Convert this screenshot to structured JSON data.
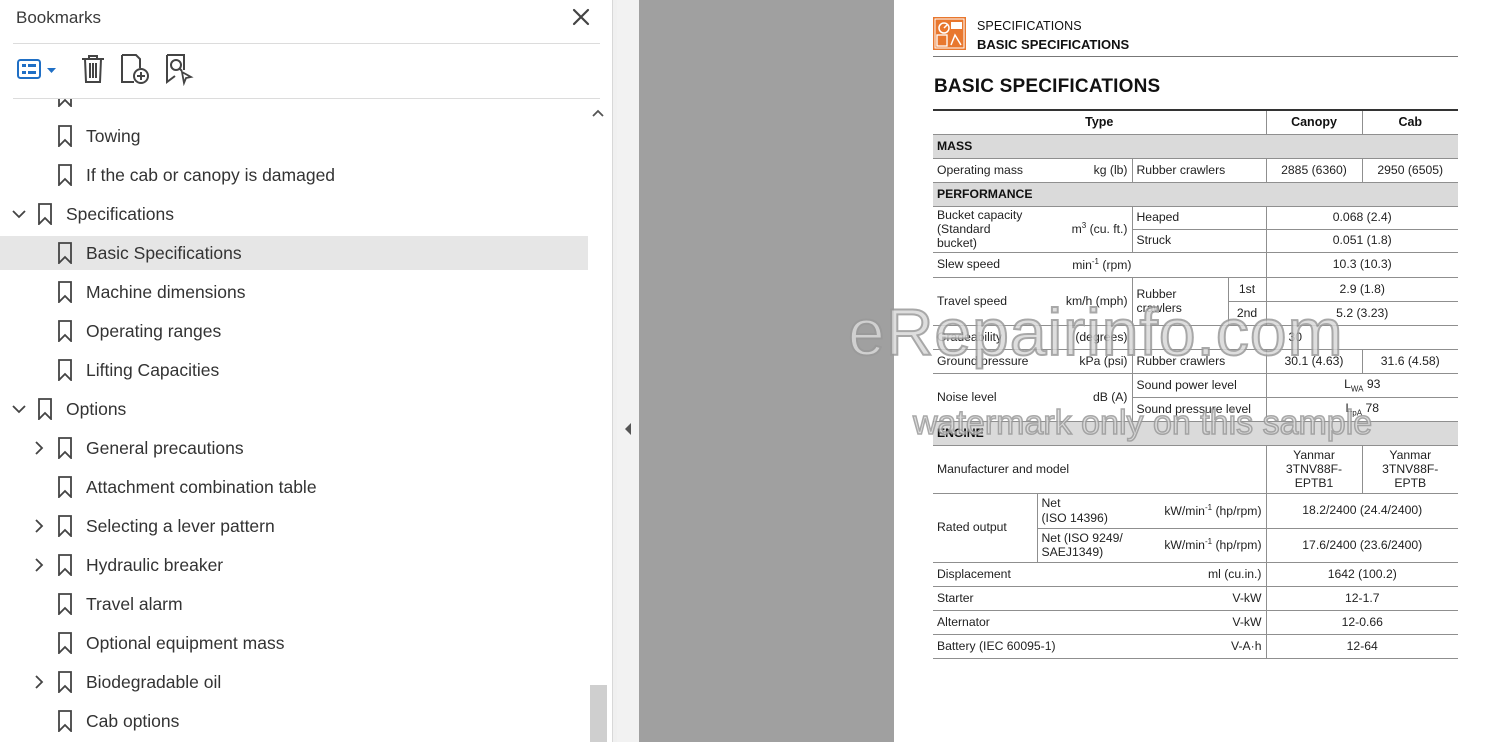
{
  "panel": {
    "title": "Bookmarks",
    "toolbar": {
      "options_icon": "list-options-icon",
      "delete_icon": "trash-icon",
      "add_icon": "add-bookmark-icon",
      "find_icon": "find-bookmark-icon"
    },
    "items": [
      {
        "label": "Towing",
        "level": 1,
        "expandable": false,
        "expanded": false,
        "selected": false
      },
      {
        "label": "If the cab or canopy is damaged",
        "level": 1,
        "expandable": false,
        "expanded": false,
        "selected": false
      },
      {
        "label": "Specifications",
        "level": 0,
        "expandable": true,
        "expanded": true,
        "selected": false
      },
      {
        "label": "Basic Specifications",
        "level": 1,
        "expandable": false,
        "expanded": false,
        "selected": true
      },
      {
        "label": "Machine dimensions",
        "level": 1,
        "expandable": false,
        "expanded": false,
        "selected": false
      },
      {
        "label": "Operating ranges",
        "level": 1,
        "expandable": false,
        "expanded": false,
        "selected": false
      },
      {
        "label": "Lifting Capacities",
        "level": 1,
        "expandable": false,
        "expanded": false,
        "selected": false
      },
      {
        "label": "Options",
        "level": 0,
        "expandable": true,
        "expanded": true,
        "selected": false
      },
      {
        "label": "General precautions",
        "level": 1,
        "expandable": true,
        "expanded": false,
        "selected": false
      },
      {
        "label": "Attachment combination table",
        "level": 1,
        "expandable": false,
        "expanded": false,
        "selected": false
      },
      {
        "label": "Selecting a lever pattern",
        "level": 1,
        "expandable": true,
        "expanded": false,
        "selected": false
      },
      {
        "label": "Hydraulic breaker",
        "level": 1,
        "expandable": true,
        "expanded": false,
        "selected": false
      },
      {
        "label": "Travel alarm",
        "level": 1,
        "expandable": false,
        "expanded": false,
        "selected": false
      },
      {
        "label": "Optional equipment mass",
        "level": 1,
        "expandable": false,
        "expanded": false,
        "selected": false
      },
      {
        "label": "Biodegradable oil",
        "level": 1,
        "expandable": true,
        "expanded": false,
        "selected": false
      },
      {
        "label": "Cab options",
        "level": 1,
        "expandable": false,
        "expanded": false,
        "selected": false
      }
    ]
  },
  "page": {
    "header_sup": "SPECIFICATIONS",
    "header_main": "BASIC SPECIFICATIONS",
    "heading": "BASIC SPECIFICATIONS",
    "table": {
      "col_type": "Type",
      "col_canopy": "Canopy",
      "col_cab": "Cab",
      "sec_mass": "MASS",
      "op_mass": {
        "label": "Operating mass",
        "unit": "kg (lb)",
        "cond": "Rubber crawlers",
        "canopy": "2885 (6360)",
        "cab": "2950 (6505)"
      },
      "sec_perf": "PERFORMANCE",
      "bucket": {
        "label1": "Bucket capacity",
        "label2": "(Standard bucket)",
        "unit_pre": "m",
        "unit_sup": "3",
        "unit_post": " (cu. ft.)",
        "heaped": "Heaped",
        "heaped_val": "0.068 (2.4)",
        "struck": "Struck",
        "struck_val": "0.051 (1.8)"
      },
      "slew": {
        "label": "Slew speed",
        "unit_pre": "min",
        "unit_sup": "-1",
        "unit_post": " (rpm)",
        "val": "10.3 (10.3)"
      },
      "travel": {
        "label": "Travel speed",
        "unit": "km/h (mph)",
        "cond": "Rubber crawlers",
        "g1": "1st",
        "g1_val": "2.9 (1.8)",
        "g2": "2nd",
        "g2_val": "5.2 (3.23)"
      },
      "grade": {
        "label": "Gradeability",
        "unit": "(degrees)",
        "val": "30"
      },
      "ground": {
        "label": "Ground pressure",
        "unit": "kPa (psi)",
        "cond": "Rubber crawlers",
        "canopy": "30.1 (4.63)",
        "cab": "31.6 (4.58)"
      },
      "noise": {
        "label": "Noise level",
        "unit": "dB (A)",
        "power": "Sound power level",
        "power_pre": "L",
        "power_sub": "WA",
        "power_val": " 93",
        "pressure": "Sound pressure level",
        "pressure_pre": "L",
        "pressure_sub": "pA",
        "pressure_val": " 78"
      },
      "sec_engine": "ENGINE",
      "manuf": {
        "label": "Manufacturer and model",
        "canopy": "Yanmar\n3TNV88F-\nEPTB1",
        "cab": "Yanmar\n3TNV88F-\nEPTB"
      },
      "rated": {
        "label": "Rated output",
        "net1_l1": "Net",
        "net1_l2": "(ISO 14396)",
        "unit1_pre": "kW/min",
        "unit1_sup": "-1",
        "unit1_post": " (hp/rpm)",
        "val1": "18.2/2400 (24.4/2400)",
        "net2_l1": "Net (ISO 9249/",
        "net2_l2": "SAEJ1349)",
        "unit2_pre": "kW/min",
        "unit2_sup": "-1",
        "unit2_post": " (hp/rpm)",
        "val2": "17.6/2400 (23.6/2400)"
      },
      "disp": {
        "label": "Displacement",
        "unit": "ml (cu.in.)",
        "val": "1642 (100.2)"
      },
      "starter": {
        "label": "Starter",
        "unit": "V-kW",
        "val": "12-1.7"
      },
      "alt": {
        "label": "Alternator",
        "unit": "V-kW",
        "val": "12-0.66"
      },
      "battery": {
        "label": "Battery (IEC 60095-1)",
        "unit": "V-A·h",
        "val": "12-64"
      }
    }
  },
  "watermark": {
    "line1": "eRepairinfo.com",
    "line2": "watermark only on this sample"
  },
  "colors": {
    "selected_row": "#e6e6e6",
    "canvas_gray": "#a0a0a0",
    "logo_orange": "#e8772e"
  }
}
